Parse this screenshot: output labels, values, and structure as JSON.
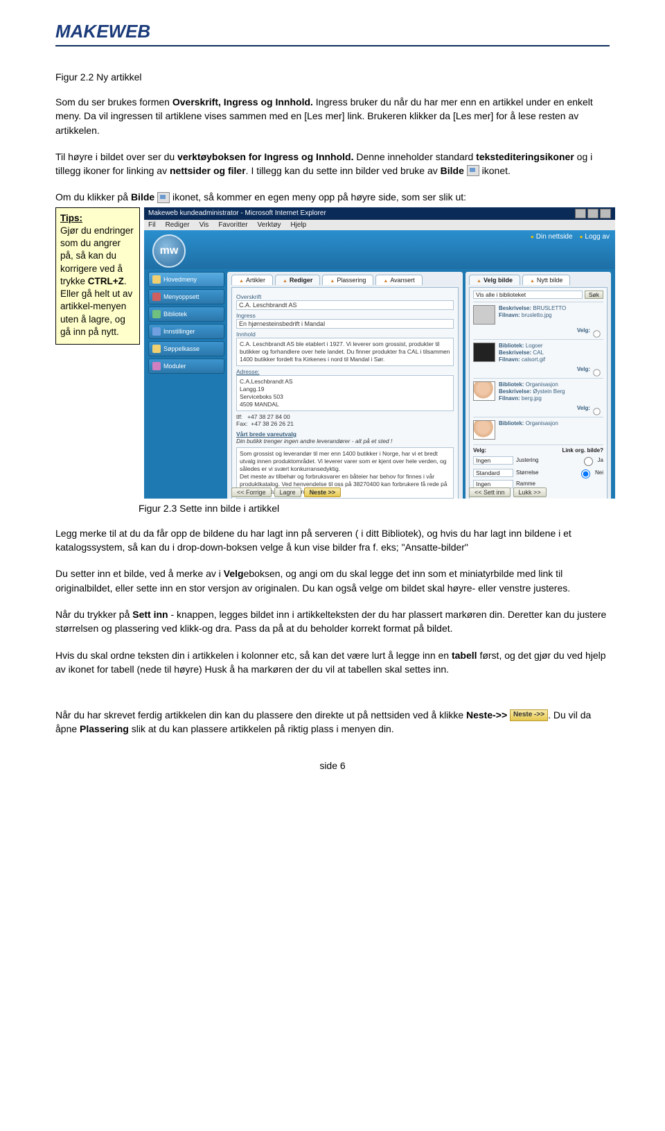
{
  "header": {
    "logo_text": "MAKEWEB"
  },
  "fig22_caption": "Figur 2.2 Ny artikkel",
  "p1": {
    "a": "Som du ser brukes formen ",
    "b": "Overskrift, Ingress og Innhold.",
    "c": " Ingress bruker du når du har mer enn en artikkel under en enkelt meny. Da vil ingressen til artiklene vises sammen med en [Les mer] link. Brukeren klikker da [Les mer] for å lese resten av artikkelen."
  },
  "p2": {
    "a": "Til høyre i bildet over ser du ",
    "b": "verktøyboksen for Ingress og Innhold.",
    "c": " Denne inneholder standard ",
    "d": "tekstediteringsikoner",
    "e": " og i tillegg ikoner for linking av ",
    "f": "nettsider og filer",
    "g": ". I tillegg kan du sette inn bilder ved bruke av ",
    "h": "Bilde",
    "i": " ikonet."
  },
  "p3": {
    "a": "Om du klikker på ",
    "b": "Bilde",
    "c": " ikonet, så kommer en egen meny opp på høyre side, som ser slik ut:"
  },
  "tips": {
    "title": "Tips:",
    "body1": "Gjør du endringer som du angrer på, så kan du korrigere ved å trykke ",
    "kbd": "CTRL+Z",
    "body2": ". Eller gå helt ut av artikkel-menyen uten å lagre, og gå inn på nytt."
  },
  "screenshot": {
    "window_title": "Makeweb kundeadministrator - Microsoft Internet Explorer",
    "menus": [
      "Fil",
      "Rediger",
      "Vis",
      "Favoritter",
      "Verktøy",
      "Hjelp"
    ],
    "topright": [
      "Din nettside",
      "Logg av"
    ],
    "sidebar": [
      {
        "label": "Hovedmeny",
        "cls": "active"
      },
      {
        "label": "Menyoppsett",
        "cls": ""
      },
      {
        "label": "Bibliotek",
        "cls": ""
      },
      {
        "label": "Innstillinger",
        "cls": ""
      },
      {
        "label": "Søppelkasse",
        "cls": ""
      },
      {
        "label": "Moduler",
        "cls": ""
      }
    ],
    "center_tabs": [
      "Artikler",
      "Rediger",
      "Plassering",
      "Avansert"
    ],
    "overskrift_lbl": "Overskrift",
    "overskrift_val": "C.A. Leschbrandt AS",
    "ingress_lbl": "Ingress",
    "ingress_val": "En hjørnesteinsbedrift i Mandal",
    "innhold_lbl": "Innhold",
    "innhold_val": "C.A. Leschbrandt AS ble etablert i 1927. Vi leverer som grossist, produkter til butikker og forhandlere over hele landet. Du finner produkter fra CAL i tilsammen 1400 butikker fordelt fra Kirkenes i nord til Mandal i Sør.",
    "adresse_lbl": "Adresse:",
    "adresse_val": "C.A.Leschbrandt AS\nLangg.19\nServiceboks 503\n4509 MANDAL",
    "tlf_lbl": "tlf:",
    "tlf": "+47 38 27 84 00",
    "fax_lbl": "Fax:",
    "fax": "+47 38 26 26 21",
    "vart_heading": "Vårt brede vareutvalg",
    "vart_line": "Din butikk trenger ingen andre leverandører - alt på et sted !",
    "vart_body": "Som grossist og leverandør til mer enn 1400 butikker i Norge, har vi et bredt utvalg innen produktområdet. Vi leverer varer som er kjent over hele verden, og således er vi svært konkurransedyktig.\nDet meste av tilbehør og forbruksvarer en båteier har behov for finnes i vår produktkatalog. Ved henvendelse til oss på 38270400 kan forbrukere få rede på hvor produktutvalget kan finnes.",
    "btn_forrige": "<< Forrige",
    "btn_lagre": "Lagre",
    "btn_neste": "Neste >>",
    "right_tabs": [
      "Velg bilde",
      "Nytt bilde"
    ],
    "vis_alle": "Vis alle i biblioteket",
    "sok": "Søk",
    "entries": [
      {
        "besk": "BRUSLETTO",
        "fil": "brusletto.jpg",
        "bib": "",
        "thumb": ""
      },
      {
        "besk": "Logoer",
        "besk2": "CAL",
        "fil": "calsort.gif",
        "bib": "",
        "thumb": "dark"
      },
      {
        "besk": "Øystein Berg",
        "fil": "berg.jpg",
        "bib": "Organisasjon",
        "thumb": "face"
      },
      {
        "besk": "",
        "fil": "",
        "bib": "Organisasjon",
        "thumb": "face"
      }
    ],
    "velg": "Velg:",
    "link_org": "Link org. bilde?",
    "footsel": [
      {
        "a": "Ingen",
        "b": "Justering",
        "c": "Ja"
      },
      {
        "a": "Standard",
        "b": "Størrelse",
        "c": "Nei"
      },
      {
        "a": "Ingen",
        "b": "Ramme",
        "c": ""
      }
    ],
    "btn_settinn": "<< Sett inn",
    "btn_lukk": "Lukk >>"
  },
  "fig23_caption": "Figur 2.3 Sette inn bilde i artikkel",
  "p4": "Legg merke til at du da får opp de bildene du har lagt inn på serveren ( i ditt Bibliotek), og hvis du har lagt inn bildene i et katalogssystem, så kan du i drop-down-boksen velge å kun vise bilder fra f. eks; \"Ansatte-bilder\"",
  "p5": {
    "a": "Du setter inn et bilde, ved å merke av i ",
    "b": "Velg",
    "c": "eboksen, og angi om du skal legge det inn som et miniatyrbilde med link til originalbildet, eller sette inn en stor versjon av originalen. Du kan også velge om bildet skal høyre- eller venstre justeres."
  },
  "p6": {
    "a": "Når du trykker på ",
    "b": "Sett inn",
    "c": " - knappen, legges bildet inn i artikkelteksten der du har plassert markøren din. Deretter kan du justere størrelsen og plassering ved klikk-og dra. Pass da på at du beholder korrekt format på bildet."
  },
  "p7": {
    "a": "Hvis du skal ordne teksten din i artikkelen i kolonner etc, så kan det være lurt å legge inn en ",
    "b": "tabell",
    "c": " først, og det gjør du ved hjelp av ikonet for tabell (nede til høyre) Husk å ha markøren der du vil at tabellen skal settes inn."
  },
  "p8": {
    "a": "Når du har skrevet ferdig artikkelen din kan du plassere den direkte ut på nettsiden ved å klikke ",
    "b": "Neste->> ",
    "neste_btn": "Neste ->>",
    "c": ". Du vil da åpne ",
    "d": "Plassering",
    "e": " slik at du kan plassere artikkelen på riktig plass i menyen din."
  },
  "footer": "side 6"
}
